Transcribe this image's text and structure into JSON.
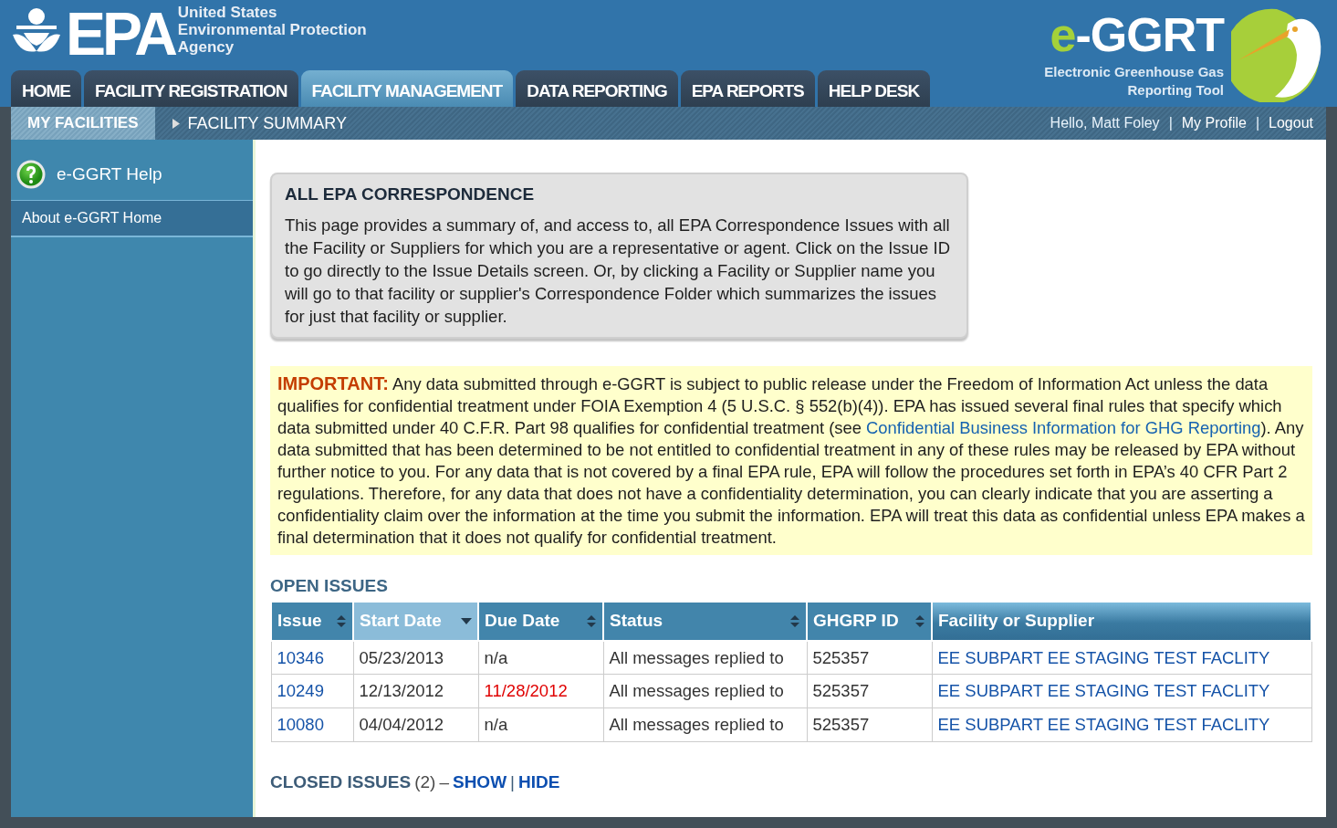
{
  "header": {
    "agency_mark": "EPA",
    "agency_lines": [
      "United States",
      "Environmental Protection",
      "Agency"
    ],
    "app_logo_prefix": "e",
    "app_logo_main": "-GGRT",
    "app_subtitle_lines": [
      "Electronic Greenhouse Gas",
      "Reporting Tool"
    ]
  },
  "tabs": [
    {
      "label": "HOME",
      "selected": false
    },
    {
      "label": "FACILITY REGISTRATION",
      "selected": false
    },
    {
      "label": "FACILITY MANAGEMENT",
      "selected": true
    },
    {
      "label": "DATA REPORTING",
      "selected": false
    },
    {
      "label": "EPA REPORTS",
      "selected": false
    },
    {
      "label": "HELP DESK",
      "selected": false
    }
  ],
  "subnav": {
    "items": [
      {
        "label": "MY FACILITIES",
        "selected": true
      },
      {
        "label": "FACILITY SUMMARY",
        "selected": false
      }
    ],
    "greeting": "Hello, Matt Foley",
    "separators": [
      "|",
      "|"
    ],
    "links": [
      "My Profile",
      "Logout"
    ]
  },
  "sidebar": {
    "help": "e-GGRT Help",
    "items": [
      {
        "label": "About e-GGRT Home"
      }
    ]
  },
  "correspondence": {
    "title": "ALL EPA CORRESPONDENCE",
    "body": "This page provides a summary of, and access to, all EPA Correspondence Issues with all the Facility or Suppliers for which you are a representative or agent. Click on the Issue ID to go directly to the Issue Details screen. Or, by clicking a Facility or Supplier name you will go to that facility or supplier's Correspondence Folder which summarizes the issues for just that facility or supplier."
  },
  "notice": {
    "label": "IMPORTANT:",
    "text_before": " Any data submitted through e-GGRT is subject to public release under the Freedom of Information Act unless the data qualifies for confidential treatment under FOIA Exemption 4 (5 U.S.C. § 552(b)(4)). EPA has issued several final rules that specify which data submitted under 40 C.F.R. Part 98 qualifies for confidential treatment (see ",
    "link": "Confidential Business Information for GHG Reporting",
    "text_after": "). Any data submitted that has been determined to be not entitled to confidential treatment in any of these rules may be released by EPA without further notice to you. For any data that is not covered by a final EPA rule, EPA will follow the procedures set forth in EPA’s 40 CFR Part 2 regulations. Therefore, for any data that does not have a confidentiality determination, you can clearly indicate that you are asserting a confidentiality claim over the information at the time you submit the information. EPA will treat this data as confidential unless EPA makes a final determination that it does not qualify for confidential treatment."
  },
  "open_issues": {
    "title": "OPEN ISSUES",
    "columns": [
      {
        "label": "Issue",
        "kind": "sortable",
        "selected": false
      },
      {
        "label": "Start Date",
        "kind": "sorted",
        "selected": true
      },
      {
        "label": "Due Date",
        "kind": "sortable",
        "selected": false
      },
      {
        "label": "Status",
        "kind": "sortable",
        "selected": false
      },
      {
        "label": "GHGRP ID",
        "kind": "sortable",
        "selected": false
      },
      {
        "label": "Facility or Supplier",
        "kind": "plain",
        "selected": false
      }
    ],
    "rows": [
      {
        "issue": "10346",
        "start_date": "05/23/2013",
        "due_date": "n/a",
        "overdue": false,
        "status": "All messages replied to",
        "ghgrp_id": "525357",
        "facility": "EE SUBPART EE STAGING TEST FACLITY"
      },
      {
        "issue": "10249",
        "start_date": "12/13/2012",
        "due_date": "11/28/2012",
        "overdue": true,
        "status": "All messages replied to",
        "ghgrp_id": "525357",
        "facility": "EE SUBPART EE STAGING TEST FACLITY"
      },
      {
        "issue": "10080",
        "start_date": "04/04/2012",
        "due_date": "n/a",
        "overdue": false,
        "status": "All messages replied to",
        "ghgrp_id": "525357",
        "facility": "EE SUBPART EE STAGING TEST FACLITY"
      }
    ]
  },
  "closed_issues": {
    "title": "CLOSED ISSUES",
    "count": "(2)",
    "dash": "–",
    "show": "SHOW",
    "separator": "|",
    "hide": "HIDE"
  }
}
